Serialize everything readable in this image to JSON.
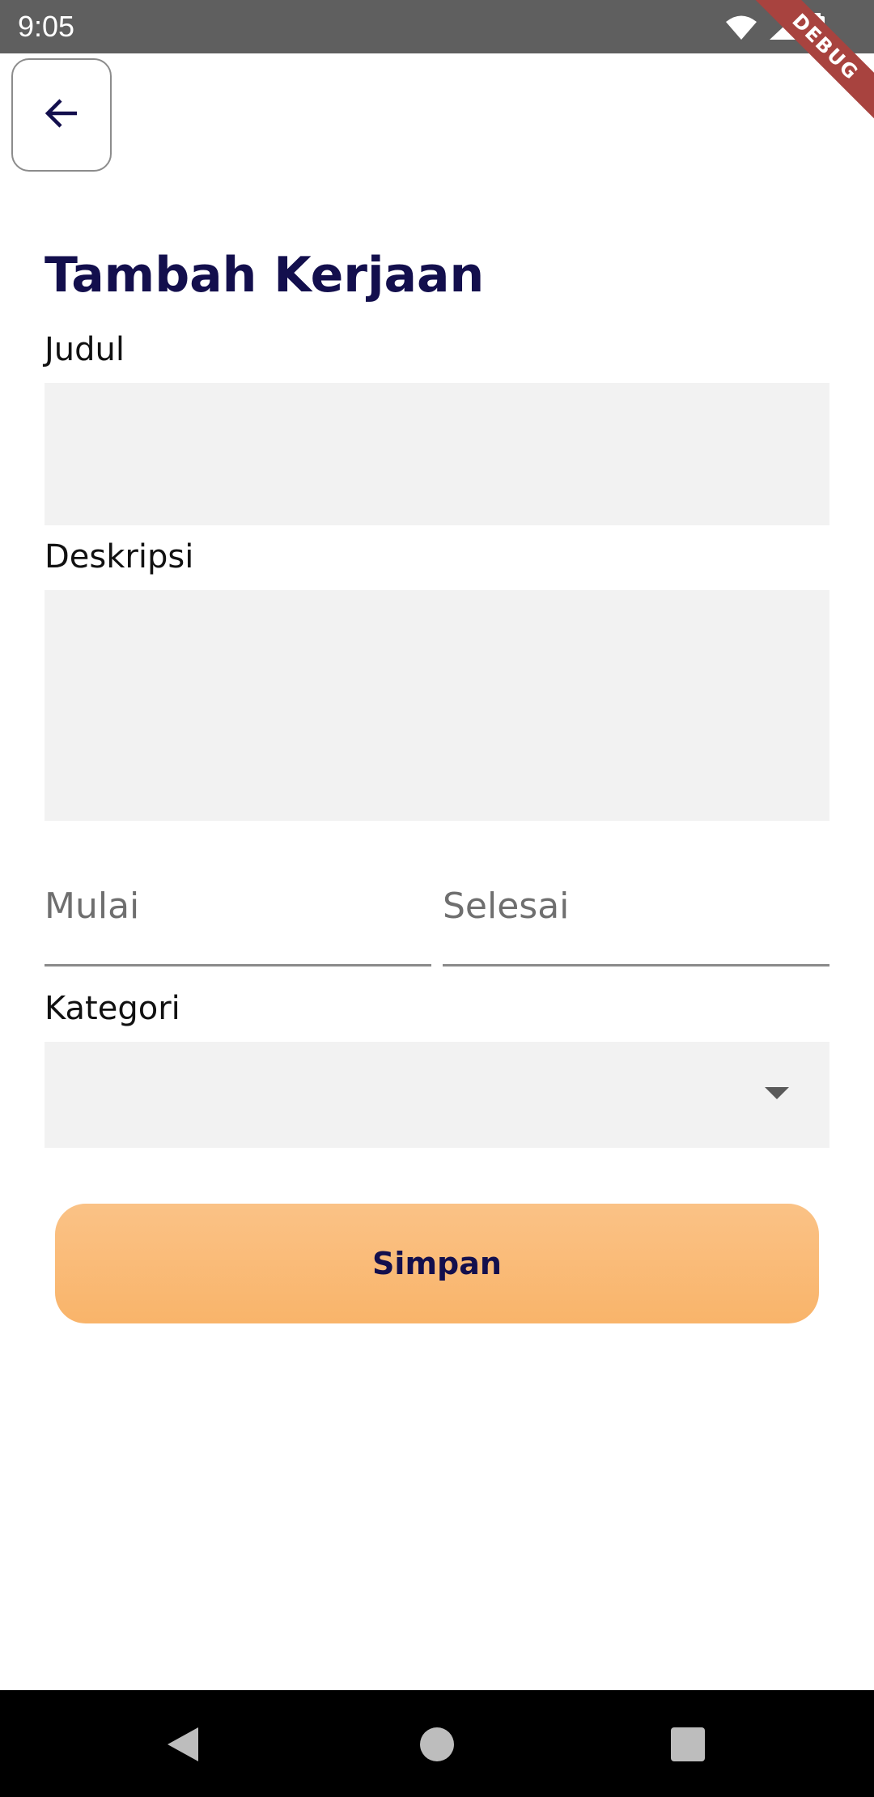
{
  "status_bar": {
    "time": "9:05",
    "icons": [
      "wifi-icon",
      "signal-icon",
      "battery-icon"
    ]
  },
  "debug_banner": "DEBUG",
  "header": {
    "back_icon": "arrow-left-icon"
  },
  "page": {
    "title": "Tambah Kerjaan"
  },
  "form": {
    "title_label": "Judul",
    "title_value": "",
    "description_label": "Deskripsi",
    "description_value": "",
    "start_placeholder": "Mulai",
    "end_placeholder": "Selesai",
    "category_label": "Kategori",
    "category_value": "",
    "save_label": "Simpan"
  },
  "nav_bar": {
    "buttons": [
      "back-triangle-icon",
      "home-circle-icon",
      "recents-square-icon"
    ]
  },
  "colors": {
    "title": "#130f4d",
    "input_fill": "#f2f2f2",
    "button_top": "#fac286",
    "button_bottom": "#f9b46a",
    "status_bar": "#5f5f5f",
    "debug_ribbon": "#a8433f"
  }
}
